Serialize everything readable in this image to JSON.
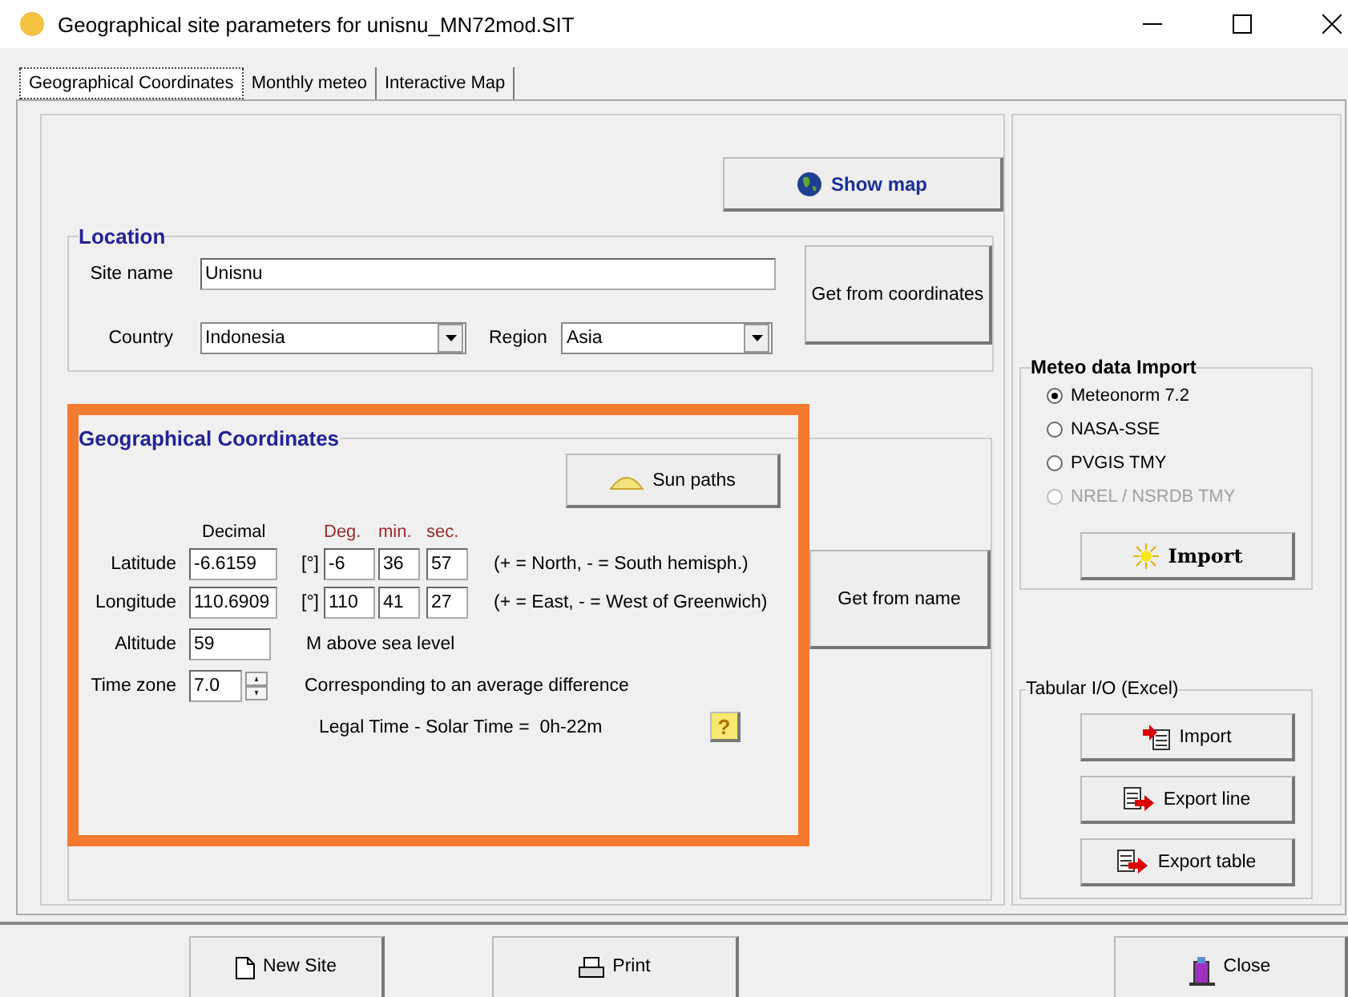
{
  "window": {
    "title": "Geographical site parameters for unisnu_MN72mod.SIT"
  },
  "tabs": [
    {
      "label": "Geographical Coordinates",
      "selected": true
    },
    {
      "label": "Monthly meteo",
      "selected": false
    },
    {
      "label": "Interactive Map",
      "selected": false
    }
  ],
  "show_map_button": "Show map",
  "location": {
    "title": "Location",
    "site_name": {
      "label": "Site name",
      "value": "Unisnu"
    },
    "country": {
      "label": "Country",
      "value": "Indonesia"
    },
    "region": {
      "label": "Region",
      "value": "Asia"
    },
    "get_from_coordinates_button": "Get from coordinates"
  },
  "coordinates": {
    "title": "Geographical Coordinates",
    "sun_paths_button": "Sun paths",
    "headers": {
      "decimal": "Decimal",
      "deg": "Deg.",
      "min": "min.",
      "sec": "sec."
    },
    "rows": [
      {
        "label": "Latitude",
        "decimal": "-6.6159",
        "unit": "[°]",
        "deg": "-6",
        "min": "36",
        "sec": "57",
        "hint": "(+ = North, - = South hemisph.)"
      },
      {
        "label": "Longitude",
        "decimal": "110.6909",
        "unit": "[°]",
        "deg": "110",
        "min": "41",
        "sec": "27",
        "hint": "(+ = East, - = West of Greenwich)"
      }
    ],
    "altitude": {
      "label": "Altitude",
      "value": "59",
      "note": "M above sea level"
    },
    "time_zone": {
      "label": "Time zone",
      "value": "7.0",
      "note": "Corresponding to an average difference"
    },
    "legal_time": "Legal Time - Solar Time =  0h-22m",
    "help_button": "?",
    "get_from_name_button": "Get from name"
  },
  "meteo_import": {
    "title": "Meteo data Import",
    "options": [
      {
        "label": "Meteonorm 7.2",
        "selected": true,
        "disabled": false
      },
      {
        "label": "NASA-SSE",
        "selected": false,
        "disabled": false
      },
      {
        "label": "PVGIS TMY",
        "selected": false,
        "disabled": false
      },
      {
        "label": "NREL / NSRDB TMY",
        "selected": false,
        "disabled": true
      }
    ],
    "import_button": "Import"
  },
  "tabular_io": {
    "title": "Tabular I/O (Excel)",
    "buttons": [
      "Import",
      "Export line",
      "Export table"
    ]
  },
  "footer_buttons": [
    "New Site",
    "Print",
    "Close"
  ]
}
